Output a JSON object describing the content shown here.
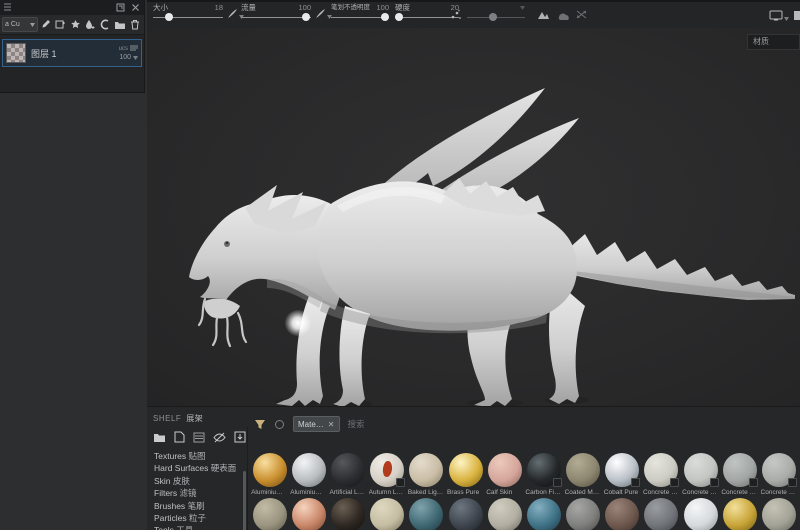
{
  "toolbar": {
    "size_label": "大小",
    "size_value": "18",
    "flow_label": "流量",
    "flow_value": "100",
    "opacity_label": "笔划不透明度",
    "opacity_value": "100",
    "hardness_label": "硬度",
    "hardness_value": "20"
  },
  "viewport": {
    "display_mode": "材质"
  },
  "layers_panel": {
    "blend_dropdown": "a Cu",
    "layer_name": "图层 1",
    "layer_meta": "ucs",
    "layer_opacity": "100"
  },
  "shelf": {
    "title_en": "SHELF",
    "title_zh": "展架",
    "filter_chip": "Mate…",
    "search_placeholder": "搜索",
    "categories": [
      {
        "en": "Textures",
        "zh": "贴图"
      },
      {
        "en": "Hard Surfaces",
        "zh": "硬表面"
      },
      {
        "en": "Skin",
        "zh": "皮肤"
      },
      {
        "en": "Filters",
        "zh": "滤镜"
      },
      {
        "en": "Brushes",
        "zh": "笔刷"
      },
      {
        "en": "Particles",
        "zh": "粒子"
      },
      {
        "en": "Tools",
        "zh": "工具"
      }
    ],
    "materials_row1": [
      {
        "name": "Aluminiu…",
        "hi": "#f8dfa0",
        "mid": "#c98f2e",
        "dark": "#6e4712",
        "badge": false
      },
      {
        "name": "Aluminiu…",
        "hi": "#f2f4f5",
        "mid": "#b9bdbf",
        "dark": "#63686b",
        "badge": false
      },
      {
        "name": "Artificial L…",
        "hi": "#55585c",
        "mid": "#2b2d30",
        "dark": "#121315",
        "badge": false
      },
      {
        "name": "Autumn L…",
        "hi": "#efece6",
        "mid": "#d6d0c6",
        "dark": "#8f897d",
        "badge": true,
        "accent": "#b23b1e"
      },
      {
        "name": "Baked Lig…",
        "hi": "#e3dbcb",
        "mid": "#c9bda6",
        "dark": "#80755d",
        "badge": false
      },
      {
        "name": "Brass Pure",
        "hi": "#fdf4c4",
        "mid": "#d9b23f",
        "dark": "#7a5c14",
        "badge": false
      },
      {
        "name": "Calf Skin",
        "hi": "#ecc9bd",
        "mid": "#d5a69b",
        "dark": "#8a6156",
        "badge": false
      },
      {
        "name": "Carbon Fi…",
        "hi": "#646e73",
        "mid": "#25282b",
        "dark": "#0d0e10",
        "badge": true
      },
      {
        "name": "Coated M…",
        "hi": "#b3ac94",
        "mid": "#8c8670",
        "dark": "#4e4a3a",
        "badge": false
      },
      {
        "name": "Cobalt Pure",
        "hi": "#ffffff",
        "mid": "#b9c0c7",
        "dark": "#5d656d",
        "badge": true
      },
      {
        "name": "Concrete …",
        "hi": "#e5e4dd",
        "mid": "#ccccc3",
        "dark": "#83837a",
        "badge": true
      },
      {
        "name": "Concrete …",
        "hi": "#dadcd9",
        "mid": "#c2c5c1",
        "dark": "#7d807c",
        "badge": true
      },
      {
        "name": "Concrete …",
        "hi": "#c0c4c2",
        "mid": "#a2a6a4",
        "dark": "#646867",
        "badge": true
      },
      {
        "name": "Concrete …",
        "hi": "#c6c8c5",
        "mid": "#a9aca8",
        "dark": "#6a6d69",
        "badge": true
      }
    ],
    "materials_row2": [
      {
        "name": "",
        "hi": "#c2bca6",
        "mid": "#9a9480",
        "dark": "#575244",
        "badge": false
      },
      {
        "name": "",
        "hi": "#f6d3bd",
        "mid": "#c9876a",
        "dark": "#6e3f28",
        "badge": false
      },
      {
        "name": "",
        "hi": "#6b5f52",
        "mid": "#2e2722",
        "dark": "#100d0b",
        "badge": false
      },
      {
        "name": "",
        "hi": "#ded8c0",
        "mid": "#c5bda2",
        "dark": "#6f6a54",
        "badge": false
      },
      {
        "name": "",
        "hi": "#7fa3ad",
        "mid": "#3f6873",
        "dark": "#1c333a",
        "badge": false
      },
      {
        "name": "",
        "hi": "#6d7681",
        "mid": "#3e454e",
        "dark": "#1a1e24",
        "badge": false
      },
      {
        "name": "",
        "hi": "#d0cdc0",
        "mid": "#b2afa2",
        "dark": "#65635a",
        "badge": false
      },
      {
        "name": "",
        "hi": "#84afc0",
        "mid": "#3f7287",
        "dark": "#1a3643",
        "badge": false
      },
      {
        "name": "",
        "hi": "#a6a7a5",
        "mid": "#7f807e",
        "dark": "#454644",
        "badge": false
      },
      {
        "name": "",
        "hi": "#9b8378",
        "mid": "#6e584e",
        "dark": "#382c27",
        "badge": false
      },
      {
        "name": "",
        "hi": "#999da1",
        "mid": "#71757a",
        "dark": "#3c3f43",
        "badge": false
      },
      {
        "name": "",
        "hi": "#f4f6f7",
        "mid": "#d5d9db",
        "dark": "#84898c",
        "badge": false
      },
      {
        "name": "",
        "hi": "#f2df9a",
        "mid": "#c7a437",
        "dark": "#6d5712",
        "badge": false
      },
      {
        "name": "",
        "hi": "#c4c3b6",
        "mid": "#a3a296",
        "dark": "#5c5b52",
        "badge": false
      }
    ]
  }
}
